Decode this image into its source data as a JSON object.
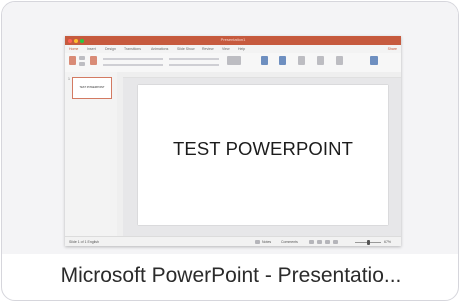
{
  "app": {
    "window_title": "Presentation1",
    "tabs": [
      "Home",
      "Insert",
      "Design",
      "Transitions",
      "Animations",
      "Slide Show",
      "Review",
      "View",
      "Help"
    ],
    "tabs_right": "Share",
    "slide_number": "1",
    "slide_thumb_text": "TEST POWERPOINT",
    "slide_title": "TEST POWERPOINT",
    "status_left": "Slide 1 of 1   English",
    "status_notes": "Notes",
    "status_comments": "Comments",
    "zoom": "67%"
  },
  "caption": "Microsoft PowerPoint - Presentatio...",
  "colors": {
    "accent": "#c65a3e",
    "card_border": "#d6d6dc"
  }
}
